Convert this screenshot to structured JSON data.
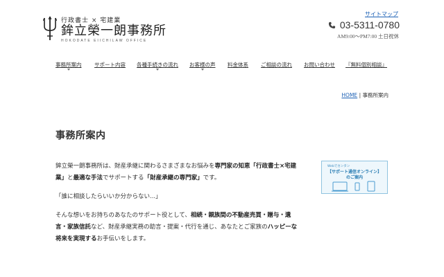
{
  "header": {
    "tagline": "行政書士 × 宅建業",
    "office_name": "鉾立榮一朗事務所",
    "office_roman": "HOKODATE EIICHILAW OFFICE",
    "sitemap_label": "サイトマップ",
    "phone": "03-5311-0780",
    "hours": "AM9:00〜PM7:00 土日祝休",
    "phone_icon": "phone-icon",
    "logo_icon": "trident-icon"
  },
  "nav": {
    "items": [
      {
        "label": "事務所案内",
        "has_submenu": true
      },
      {
        "label": "サポート内容",
        "has_submenu": false
      },
      {
        "label": "各種手続きの流れ",
        "has_submenu": true
      },
      {
        "label": "お客様の声",
        "has_submenu": true
      },
      {
        "label": "料金体系",
        "has_submenu": false
      },
      {
        "label": "ご相談の流れ",
        "has_submenu": false
      },
      {
        "label": "お問い合わせ",
        "has_submenu": false
      },
      {
        "label": "『無料個別相談』",
        "has_submenu": false
      }
    ]
  },
  "breadcrumb": {
    "home": "HOME",
    "separator": "|",
    "current": "事務所案内"
  },
  "page": {
    "title": "事務所案内"
  },
  "content": {
    "p1": {
      "t1": "鉾立榮一朗事務所は、財産承継に関わるさまざまなお悩みを",
      "b1": "専門家の知恵「行政書士×宅建業」",
      "t2": "と",
      "b2": "最適な手法",
      "t3": "でサポートする",
      "b3": "「財産承継の専門家」",
      "t4": "です。"
    },
    "p2": "「誰に相談したらいいか分からない...」",
    "p3": {
      "t1": "そんな想いをお持ちのあなたのサポート役として、",
      "b1": "相続・親族間の不動産売買・贈与・遺言・家族信託",
      "t2": "など、財産承継実務の助言・提案・代行を通じ、あなたとご家族の",
      "b2": "ハッピーな将来を実現する",
      "t3": "お手伝いをします。"
    }
  },
  "banner": {
    "line1": "Webでカンタン",
    "line2": "【サポート通信オンライン】",
    "line3": "のご案内",
    "accent": "#2a7db3",
    "devices_icon": "devices-icon"
  },
  "colors": {
    "link": "#1a5fb4",
    "text": "#333333"
  }
}
